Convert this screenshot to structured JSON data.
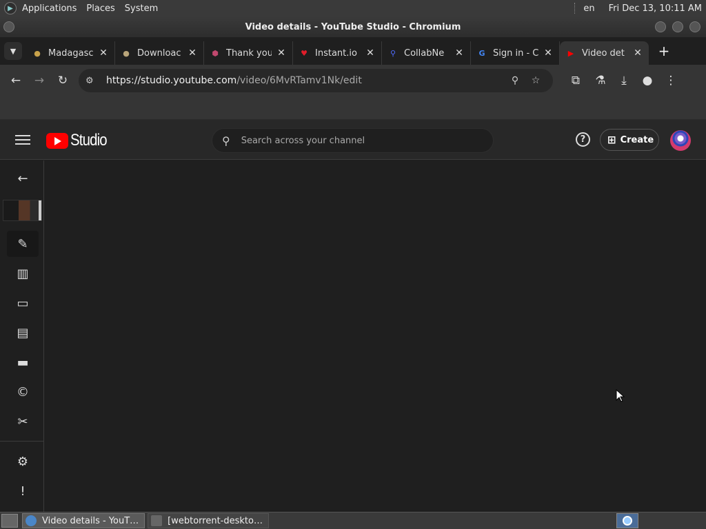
{
  "topbar": {
    "menu": [
      "Applications",
      "Places",
      "System"
    ],
    "lang": "en",
    "clock": "Fri Dec 13, 10:11 AM"
  },
  "window": {
    "title": "Video details - YouTube Studio - Chromium"
  },
  "tabs": [
    {
      "label": "Madagasc",
      "favicon": "globe-icon",
      "color": "#c8a24a"
    },
    {
      "label": "Downloac",
      "favicon": "globe-icon",
      "color": "#b9a57a"
    },
    {
      "label": "Thank you",
      "favicon": "shield-icon",
      "color": "#c0486e"
    },
    {
      "label": "Instant.io",
      "favicon": "heart-icon",
      "color": "#e11d2a"
    },
    {
      "label": "CollabNe",
      "favicon": "search-icon",
      "color": "#4f6bff"
    },
    {
      "label": "Sign in - C",
      "favicon": "google-icon",
      "color": "#4285f4"
    },
    {
      "label": "Video det",
      "favicon": "youtube-icon",
      "color": "#ff0000",
      "active": true
    }
  ],
  "address_bar": {
    "url_host": "https://studio.youtube.com",
    "url_path": "/video/6MvRTamv1Nk/edit"
  },
  "studio": {
    "logo_text": "Studio",
    "search_placeholder": "Search across your channel",
    "create_label": "Create"
  },
  "sidebar": {
    "items": [
      {
        "name": "back-arrow-icon",
        "glyph": "←"
      },
      {
        "name": "edit-details-icon",
        "glyph": "✎",
        "active": true
      },
      {
        "name": "analytics-icon",
        "glyph": "▥"
      },
      {
        "name": "editor-icon",
        "glyph": "▭"
      },
      {
        "name": "comments-icon",
        "glyph": "▤"
      },
      {
        "name": "subtitles-icon",
        "glyph": "▬"
      },
      {
        "name": "copyright-icon",
        "glyph": "©"
      },
      {
        "name": "clips-scissors-icon",
        "glyph": "✂"
      },
      {
        "name": "settings-icon",
        "glyph": "⚙"
      },
      {
        "name": "feedback-icon",
        "glyph": "!"
      }
    ]
  },
  "taskbar": {
    "tasks": [
      "Video details - YouT…",
      "[webtorrent-deskto…"
    ]
  }
}
